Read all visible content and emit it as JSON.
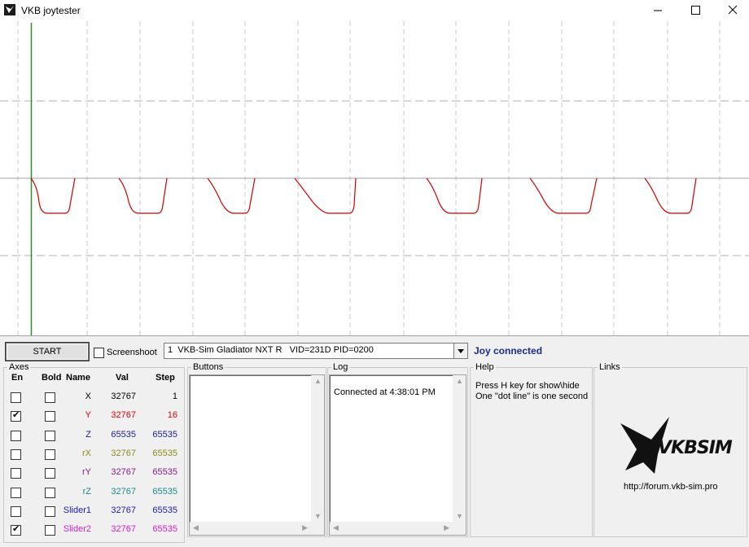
{
  "window": {
    "title": "VKB joytester",
    "icon": "vkb-bird-icon",
    "controls": [
      "minimize",
      "maximize",
      "close"
    ]
  },
  "toolbar": {
    "start_label": "START",
    "screenshoot_label": "Screenshoot",
    "screenshoot_checked": false,
    "device_selected": "1  VKB-Sim Gladiator NXT R   VID=231D PID=0200",
    "status": "Joy connected"
  },
  "axes": {
    "group_label": "Axes",
    "headers": {
      "en": "En",
      "bold": "Bold",
      "name": "Name",
      "val": "Val",
      "step": "Step"
    },
    "rows": [
      {
        "en": false,
        "bold": false,
        "name": "X",
        "val": "32767",
        "step": "1",
        "color": "#000000"
      },
      {
        "en": true,
        "bold": false,
        "name": "Y",
        "val": "32767",
        "step": "16",
        "color": "#e00000"
      },
      {
        "en": false,
        "bold": false,
        "name": "Z",
        "val": "65535",
        "step": "65535",
        "color": "#1a1a9a"
      },
      {
        "en": false,
        "bold": false,
        "name": "rX",
        "val": "32767",
        "step": "65535",
        "color": "#8a8a20"
      },
      {
        "en": false,
        "bold": false,
        "name": "rY",
        "val": "32767",
        "step": "65535",
        "color": "#8a1a8a"
      },
      {
        "en": false,
        "bold": false,
        "name": "rZ",
        "val": "32767",
        "step": "65535",
        "color": "#1a8a8a"
      },
      {
        "en": false,
        "bold": false,
        "name": "Slider1",
        "val": "32767",
        "step": "65535",
        "color": "#1a1ab0"
      },
      {
        "en": true,
        "bold": false,
        "name": "Slider2",
        "val": "32767",
        "step": "65535",
        "color": "#d020d0"
      }
    ]
  },
  "buttons_panel": {
    "label": "Buttons"
  },
  "log_panel": {
    "label": "Log",
    "lines": [
      "Connected at 4:38:01 PM"
    ]
  },
  "help_panel": {
    "label": "Help",
    "line1": "Press H key for show\\hide",
    "line2": "One \"dot line\" is one second"
  },
  "links_panel": {
    "label": "Links",
    "logo_text": "VKBSIM",
    "url": "http://forum.vkb-sim.pro"
  },
  "graph": {
    "trace_color": "#d00000",
    "cursor_color": "#2e8b2e",
    "grid_color": "#b0b0b0"
  }
}
